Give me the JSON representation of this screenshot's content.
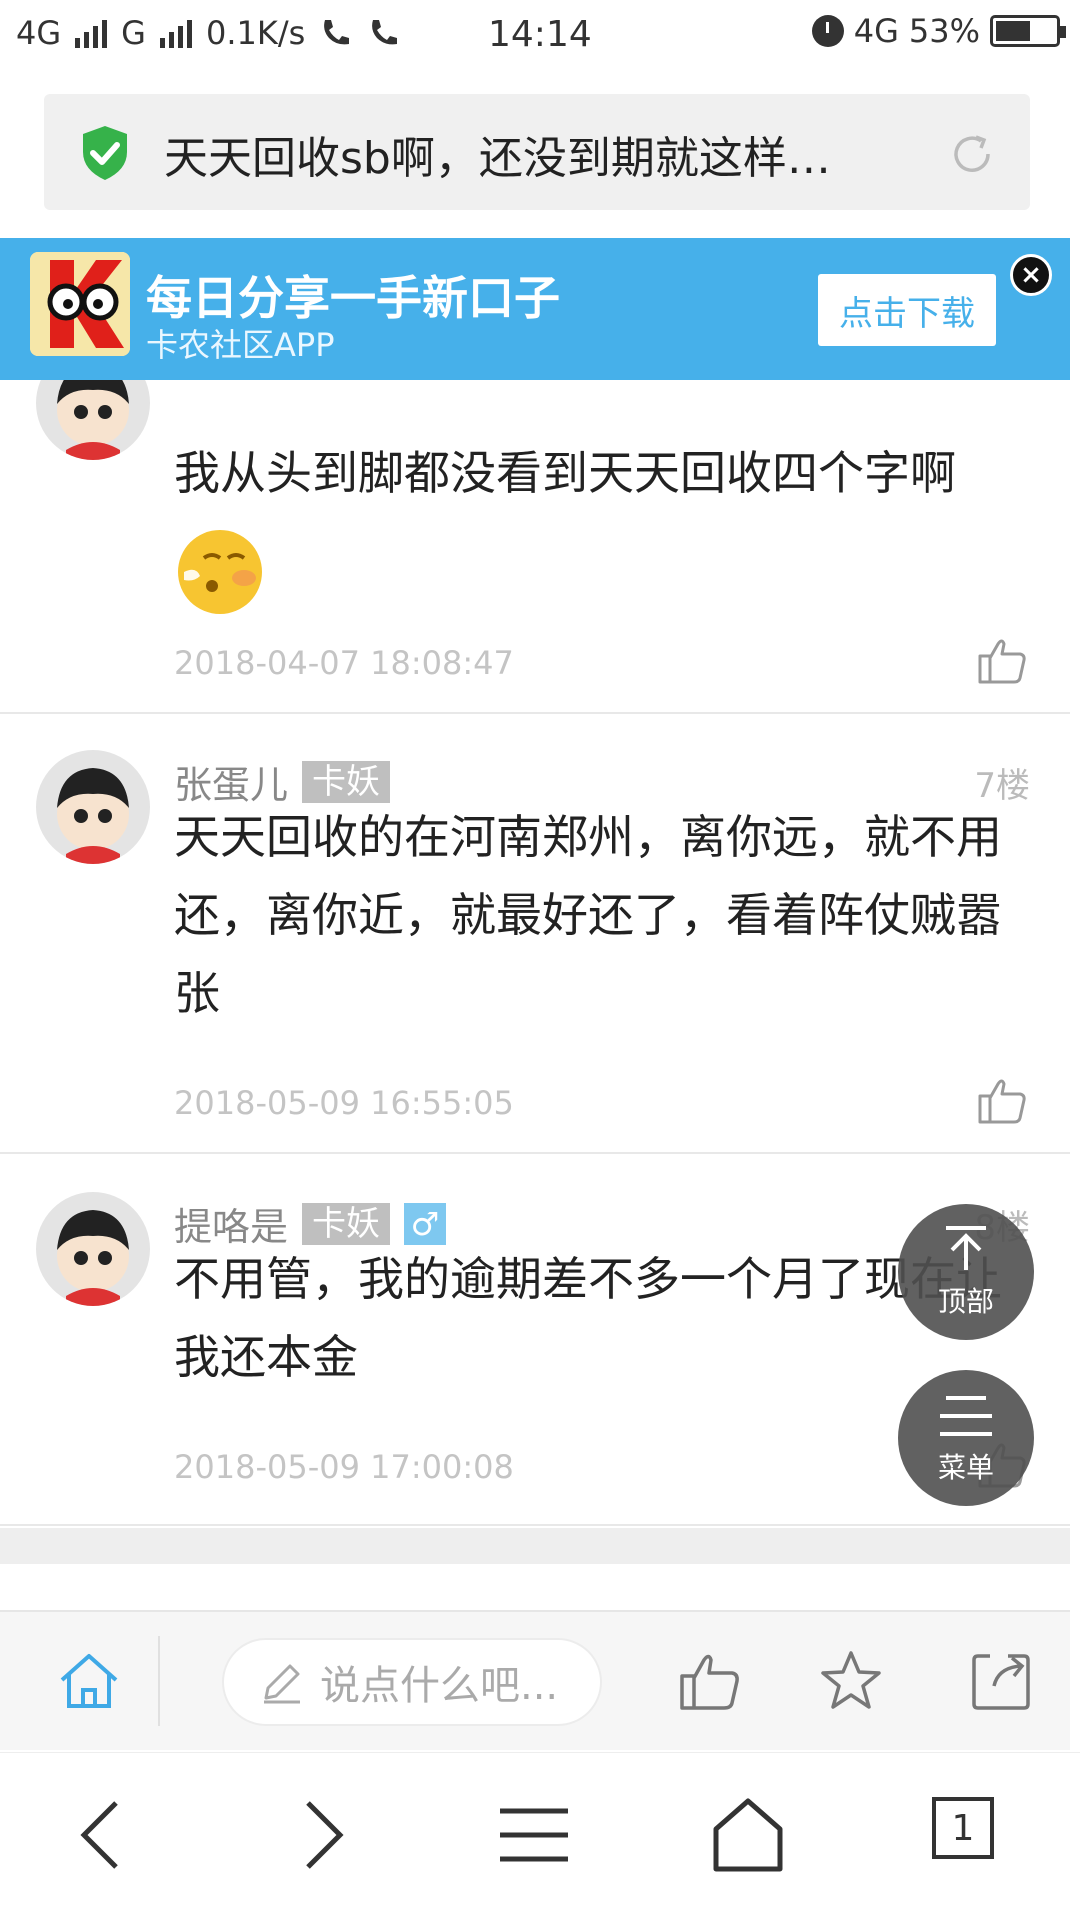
{
  "status_bar": {
    "left_text": [
      "4G",
      "G",
      "0.1K/s"
    ],
    "time": "14:14",
    "right_network": "4G",
    "battery": "53%"
  },
  "url_bar": {
    "title": "天天回收sb啊，还没到期就这样…",
    "secure_icon": "shield-check-icon",
    "reload_icon": "reload-icon"
  },
  "banner": {
    "title": "每日分享一手新口子",
    "subtitle": "卡农社区APP",
    "download_label": "点击下载",
    "close_label": "×"
  },
  "comments": [
    {
      "text": "我从头到脚都没看到天天回收四个字啊",
      "has_emoji": true,
      "time": "2018-04-07 18:08:47"
    },
    {
      "user": "张蛋儿",
      "badge": "卡妖",
      "floor": "7楼",
      "text": "天天回收的在河南郑州，离你远，就不用还，离你近，就最好还了，看着阵仗贼嚣张",
      "time": "2018-05-09 16:55:05"
    },
    {
      "user": "提咯是",
      "badge": "卡妖",
      "gender": "♂",
      "floor": "8楼",
      "text": "不用管，我的逾期差不多一个月了现在让我还本金",
      "time": "2018-05-09 17:00:08"
    }
  ],
  "float_buttons": {
    "top_label": "顶部",
    "menu_label": "菜单"
  },
  "action_bar": {
    "comment_placeholder": "说点什么吧..."
  },
  "system_nav": {
    "tab_count": "1"
  },
  "colors": {
    "banner_blue": "#46b0ea",
    "accent": "#3fa9e6",
    "shield_green": "#36b24a"
  }
}
